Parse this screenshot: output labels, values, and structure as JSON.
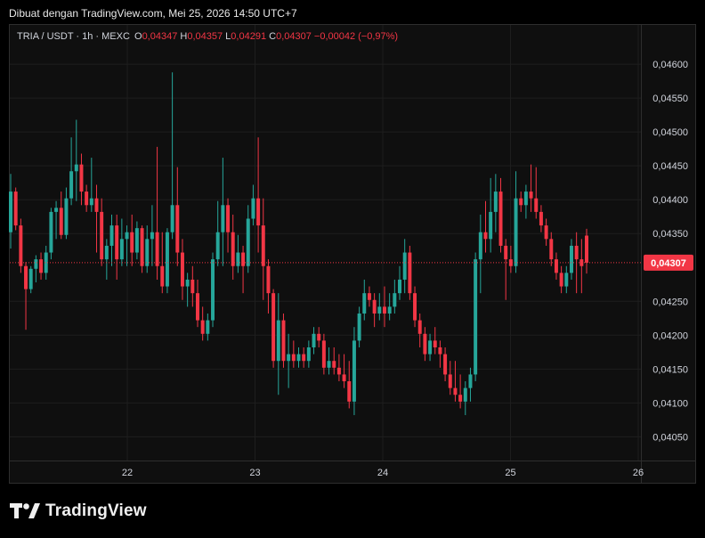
{
  "header": {
    "text": "Dibuat dengan TradingView.com, Mei 25, 2026 14:50 UTC+7"
  },
  "legend": {
    "symbol": "TRIA / USDT · 1h · MEXC",
    "o_label": "O",
    "o_value": "0,04347",
    "h_label": "H",
    "h_value": "0,04357",
    "l_label": "L",
    "l_value": "0,04291",
    "c_label": "C",
    "c_value": "0,04307",
    "change": "−0,00042 (−0,97%)"
  },
  "brand": {
    "name": "TradingView",
    "logo_icon": "tradingview-logo-icon"
  },
  "colors": {
    "up": "#26a69a",
    "down": "#f23645",
    "grid": "#1e1e1e",
    "bg": "#0f0f0f"
  },
  "chart_data": {
    "type": "candlestick",
    "price_tag": "0,04307",
    "y_ticks": [
      "0,04600",
      "0,04550",
      "0,04500",
      "0,04450",
      "0,04400",
      "0,04350",
      "0,04250",
      "0,04200",
      "0,04150",
      "0,04100",
      "0,04050"
    ],
    "y_tick_values": [
      0.046,
      0.0455,
      0.045,
      0.0445,
      0.044,
      0.0435,
      0.0425,
      0.042,
      0.0415,
      0.041,
      0.0405
    ],
    "x_ticks": [
      "22",
      "23",
      "24",
      "25",
      "26"
    ],
    "ylim": [
      0.04015,
      0.04658
    ],
    "last_close": 0.04307,
    "candles_ohlc": [
      [
        0.04352,
        0.04438,
        0.04328,
        0.04412
      ],
      [
        0.04412,
        0.04418,
        0.04355,
        0.04362
      ],
      [
        0.04362,
        0.04372,
        0.04292,
        0.04302
      ],
      [
        0.04302,
        0.04308,
        0.04208,
        0.04268
      ],
      [
        0.04268,
        0.04302,
        0.04262,
        0.04298
      ],
      [
        0.04298,
        0.04318,
        0.04278,
        0.04312
      ],
      [
        0.04312,
        0.04322,
        0.04282,
        0.04292
      ],
      [
        0.04292,
        0.04332,
        0.04282,
        0.04322
      ],
      [
        0.04322,
        0.04388,
        0.04312,
        0.04382
      ],
      [
        0.04382,
        0.04398,
        0.04342,
        0.04388
      ],
      [
        0.04388,
        0.04412,
        0.04342,
        0.04348
      ],
      [
        0.04348,
        0.04418,
        0.04342,
        0.04402
      ],
      [
        0.04402,
        0.04492,
        0.04392,
        0.04442
      ],
      [
        0.04442,
        0.04518,
        0.04398,
        0.04452
      ],
      [
        0.04452,
        0.04468,
        0.04392,
        0.04412
      ],
      [
        0.04412,
        0.04422,
        0.04382,
        0.04392
      ],
      [
        0.04392,
        0.04462,
        0.04382,
        0.04402
      ],
      [
        0.04402,
        0.04422,
        0.04322,
        0.04382
      ],
      [
        0.04382,
        0.04402,
        0.04302,
        0.04312
      ],
      [
        0.04312,
        0.04342,
        0.04282,
        0.04332
      ],
      [
        0.04332,
        0.04378,
        0.04302,
        0.04362
      ],
      [
        0.04362,
        0.04378,
        0.04282,
        0.04312
      ],
      [
        0.04312,
        0.04372,
        0.04302,
        0.04342
      ],
      [
        0.04342,
        0.04362,
        0.04302,
        0.04352
      ],
      [
        0.04352,
        0.04378,
        0.04302,
        0.04322
      ],
      [
        0.04322,
        0.04368,
        0.04312,
        0.04358
      ],
      [
        0.04358,
        0.04362,
        0.04292,
        0.04302
      ],
      [
        0.04302,
        0.04362,
        0.04292,
        0.04342
      ],
      [
        0.04342,
        0.04392,
        0.04302,
        0.04352
      ],
      [
        0.04352,
        0.04478,
        0.04282,
        0.04302
      ],
      [
        0.04302,
        0.04352,
        0.04262,
        0.04272
      ],
      [
        0.04272,
        0.04358,
        0.04262,
        0.04352
      ],
      [
        0.04352,
        0.04588,
        0.04342,
        0.04392
      ],
      [
        0.04392,
        0.04448,
        0.04302,
        0.04322
      ],
      [
        0.04322,
        0.04342,
        0.04252,
        0.04272
      ],
      [
        0.04272,
        0.04292,
        0.04242,
        0.04282
      ],
      [
        0.04282,
        0.04302,
        0.04242,
        0.04262
      ],
      [
        0.04262,
        0.04282,
        0.04212,
        0.04222
      ],
      [
        0.04222,
        0.04242,
        0.04192,
        0.04202
      ],
      [
        0.04202,
        0.04232,
        0.04192,
        0.04222
      ],
      [
        0.04222,
        0.04322,
        0.04212,
        0.04312
      ],
      [
        0.04312,
        0.04398,
        0.04302,
        0.04352
      ],
      [
        0.04352,
        0.04462,
        0.04302,
        0.04392
      ],
      [
        0.04392,
        0.04402,
        0.04322,
        0.04352
      ],
      [
        0.04352,
        0.04378,
        0.04282,
        0.04302
      ],
      [
        0.04302,
        0.04348,
        0.04292,
        0.04322
      ],
      [
        0.04322,
        0.04332,
        0.04262,
        0.04302
      ],
      [
        0.04302,
        0.04392,
        0.04292,
        0.04372
      ],
      [
        0.04372,
        0.04422,
        0.04362,
        0.04402
      ],
      [
        0.04402,
        0.04492,
        0.04322,
        0.04362
      ],
      [
        0.04362,
        0.04402,
        0.04252,
        0.04302
      ],
      [
        0.04302,
        0.04312,
        0.04232,
        0.04262
      ],
      [
        0.04262,
        0.04268,
        0.04152,
        0.04162
      ],
      [
        0.04162,
        0.04262,
        0.04112,
        0.04222
      ],
      [
        0.04222,
        0.04232,
        0.04152,
        0.04162
      ],
      [
        0.04162,
        0.04202,
        0.04122,
        0.04172
      ],
      [
        0.04172,
        0.04192,
        0.04152,
        0.04162
      ],
      [
        0.04162,
        0.04182,
        0.04152,
        0.04172
      ],
      [
        0.04172,
        0.04182,
        0.04152,
        0.04162
      ],
      [
        0.04162,
        0.04192,
        0.04152,
        0.04182
      ],
      [
        0.04182,
        0.04212,
        0.04172,
        0.04202
      ],
      [
        0.04202,
        0.04212,
        0.04182,
        0.04192
      ],
      [
        0.04192,
        0.04202,
        0.04142,
        0.04152
      ],
      [
        0.04152,
        0.04182,
        0.04142,
        0.04162
      ],
      [
        0.04162,
        0.04182,
        0.04142,
        0.04152
      ],
      [
        0.04152,
        0.04172,
        0.04132,
        0.04142
      ],
      [
        0.04142,
        0.04172,
        0.04122,
        0.04132
      ],
      [
        0.04132,
        0.04162,
        0.04092,
        0.04102
      ],
      [
        0.04102,
        0.04212,
        0.04082,
        0.04192
      ],
      [
        0.04192,
        0.04242,
        0.04182,
        0.04232
      ],
      [
        0.04232,
        0.04282,
        0.04222,
        0.04262
      ],
      [
        0.04262,
        0.04272,
        0.04242,
        0.04252
      ],
      [
        0.04252,
        0.04262,
        0.04212,
        0.04232
      ],
      [
        0.04232,
        0.04262,
        0.04222,
        0.04242
      ],
      [
        0.04242,
        0.04272,
        0.04212,
        0.04232
      ],
      [
        0.04232,
        0.04262,
        0.04222,
        0.04242
      ],
      [
        0.04242,
        0.04282,
        0.04232,
        0.04262
      ],
      [
        0.04262,
        0.04302,
        0.04252,
        0.04282
      ],
      [
        0.04282,
        0.04342,
        0.04262,
        0.04322
      ],
      [
        0.04322,
        0.04332,
        0.04252,
        0.04262
      ],
      [
        0.04262,
        0.04272,
        0.04212,
        0.04222
      ],
      [
        0.04222,
        0.04232,
        0.04182,
        0.04202
      ],
      [
        0.04202,
        0.04212,
        0.04162,
        0.04172
      ],
      [
        0.04172,
        0.04202,
        0.04162,
        0.04192
      ],
      [
        0.04192,
        0.04212,
        0.04172,
        0.04182
      ],
      [
        0.04182,
        0.04192,
        0.04152,
        0.04172
      ],
      [
        0.04172,
        0.04182,
        0.04132,
        0.04142
      ],
      [
        0.04142,
        0.04162,
        0.04112,
        0.04122
      ],
      [
        0.04122,
        0.04162,
        0.04102,
        0.04112
      ],
      [
        0.04112,
        0.04142,
        0.04092,
        0.04102
      ],
      [
        0.04102,
        0.04132,
        0.04082,
        0.04122
      ],
      [
        0.04122,
        0.04152,
        0.04102,
        0.04142
      ],
      [
        0.04142,
        0.04322,
        0.04132,
        0.04312
      ],
      [
        0.04312,
        0.04378,
        0.04262,
        0.04352
      ],
      [
        0.04352,
        0.04398,
        0.04322,
        0.04342
      ],
      [
        0.04342,
        0.04432,
        0.04322,
        0.04382
      ],
      [
        0.04382,
        0.04438,
        0.04352,
        0.04412
      ],
      [
        0.04412,
        0.04432,
        0.04322,
        0.04332
      ],
      [
        0.04332,
        0.04342,
        0.04252,
        0.04312
      ],
      [
        0.04312,
        0.04332,
        0.04292,
        0.04302
      ],
      [
        0.04302,
        0.04442,
        0.04292,
        0.04402
      ],
      [
        0.04402,
        0.04412,
        0.04382,
        0.04392
      ],
      [
        0.04392,
        0.04422,
        0.04372,
        0.04412
      ],
      [
        0.04412,
        0.04452,
        0.04382,
        0.04402
      ],
      [
        0.04402,
        0.04448,
        0.04372,
        0.04382
      ],
      [
        0.04382,
        0.04392,
        0.04352,
        0.04362
      ],
      [
        0.04362,
        0.04372,
        0.04332,
        0.04342
      ],
      [
        0.04342,
        0.04352,
        0.04302,
        0.04312
      ],
      [
        0.04312,
        0.04322,
        0.04282,
        0.04292
      ],
      [
        0.04292,
        0.04302,
        0.04262,
        0.04272
      ],
      [
        0.04272,
        0.04302,
        0.04262,
        0.04292
      ],
      [
        0.04292,
        0.04342,
        0.04282,
        0.04332
      ],
      [
        0.04332,
        0.04352,
        0.04262,
        0.04312
      ],
      [
        0.04312,
        0.04342,
        0.04262,
        0.04302
      ],
      [
        0.04347,
        0.04357,
        0.04291,
        0.04307
      ]
    ]
  }
}
